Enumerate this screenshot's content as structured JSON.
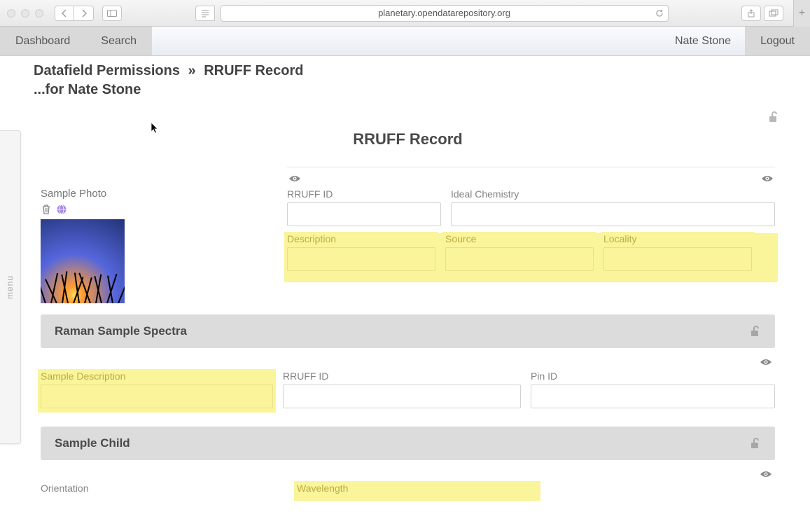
{
  "browser": {
    "url": "planetary.opendatarepository.org"
  },
  "nav": {
    "dashboard": "Dashboard",
    "search": "Search",
    "user": "Nate Stone",
    "logout": "Logout"
  },
  "menu_handle": "menu",
  "breadcrumb": {
    "root": "Datafield Permissions",
    "sep": "»",
    "leaf": "RRUFF Record"
  },
  "subheading": "...for Nate Stone",
  "record_title": "RRUFF Record",
  "sample_photo_label": "Sample Photo",
  "fields_top": {
    "rruff_id": "RRUFF ID",
    "ideal_chem": "Ideal Chemistry",
    "description": "Description",
    "source": "Source",
    "locality": "Locality"
  },
  "sections": {
    "raman": "Raman Sample Spectra",
    "child": "Sample Child"
  },
  "fields_raman": {
    "sample_desc": "Sample Description",
    "rruff_id": "RRUFF ID",
    "pin_id": "Pin ID"
  },
  "fields_child": {
    "orientation": "Orientation",
    "wavelength": "Wavelength"
  }
}
